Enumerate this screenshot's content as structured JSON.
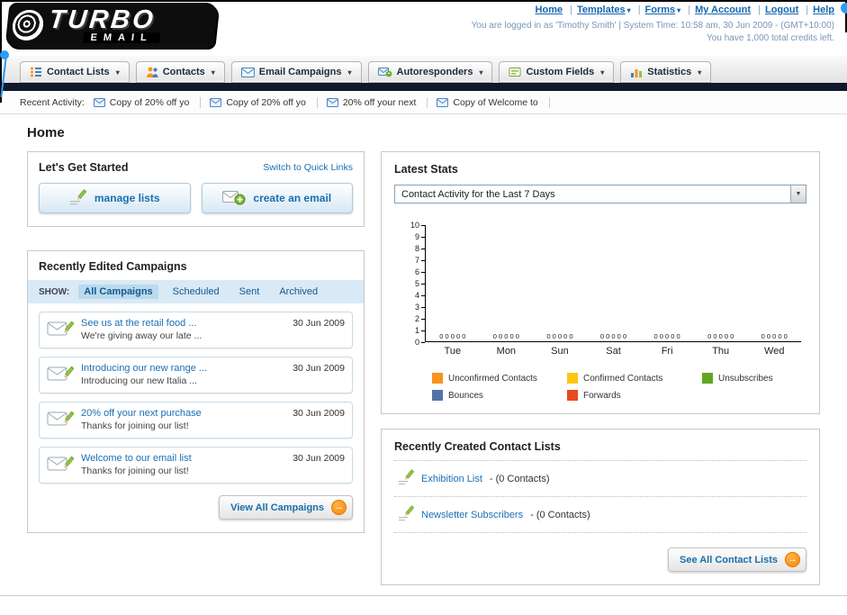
{
  "colors": {
    "link_blue": "#1b6fb5",
    "accent_orange": "#f7941d",
    "nav_dark_bar": "#10182b",
    "filter_bar_blue": "#d9e9f6"
  },
  "header": {
    "logo_line1": "TURBO",
    "logo_line2": "EMAIL",
    "nav": [
      {
        "label": "Home",
        "has_menu": false
      },
      {
        "label": "Templates",
        "has_menu": true
      },
      {
        "label": "Forms",
        "has_menu": true
      },
      {
        "label": "My Account",
        "has_menu": false
      },
      {
        "label": "Logout",
        "has_menu": false
      },
      {
        "label": "Help",
        "has_menu": false
      }
    ],
    "login_info": "You are logged in as 'Timothy Smith' | System Time: 10:58 am, 30 Jun 2009 - (GMT+10:00)",
    "credits": "You have 1,000 total credits left."
  },
  "tabs": [
    {
      "label": "Contact Lists"
    },
    {
      "label": "Contacts"
    },
    {
      "label": "Email Campaigns"
    },
    {
      "label": "Autoresponders"
    },
    {
      "label": "Custom Fields"
    },
    {
      "label": "Statistics"
    }
  ],
  "recent_activity": {
    "label": "Recent Activity:",
    "items": [
      "Copy of 20% off yo",
      "Copy of 20% off yo",
      "20% off your next",
      "Copy of Welcome to"
    ]
  },
  "page": {
    "title": "Home"
  },
  "get_started": {
    "title": "Let's Get Started",
    "switch_link": "Switch to Quick Links",
    "manage_lists": "manage lists",
    "create_email": "create an email"
  },
  "campaigns": {
    "title": "Recently Edited Campaigns",
    "show_label": "SHOW:",
    "filters": [
      "All Campaigns",
      "Scheduled",
      "Sent",
      "Archived"
    ],
    "selected_filter": "All Campaigns",
    "items": [
      {
        "title": "See us at the retail food ...",
        "subtitle": "We're giving away our late ...",
        "date": "30 Jun 2009"
      },
      {
        "title": "Introducing our new range ...",
        "subtitle": "Introducing our new Italia ...",
        "date": "30 Jun 2009"
      },
      {
        "title": "20% off your next purchase",
        "subtitle": "Thanks for joining our list!",
        "date": "30 Jun 2009"
      },
      {
        "title": "Welcome to our email list",
        "subtitle": "Thanks for joining our list!",
        "date": "30 Jun 2009"
      }
    ],
    "view_all": "View All Campaigns"
  },
  "stats": {
    "title": "Latest Stats",
    "filter_selected": "Contact Activity for the Last 7 Days"
  },
  "contact_lists": {
    "title": "Recently Created Contact Lists",
    "items": [
      {
        "name": "Exhibition List",
        "suffix": "- (0 Contacts)"
      },
      {
        "name": "Newsletter Subscribers",
        "suffix": "- (0 Contacts)"
      }
    ],
    "see_all": "See All Contact Lists"
  },
  "chart_data": {
    "type": "bar",
    "title": "Contact Activity for the Last 7 Days",
    "categories": [
      "Tue",
      "Mon",
      "Sun",
      "Sat",
      "Fri",
      "Thu",
      "Wed"
    ],
    "series": [
      {
        "name": "Unconfirmed Contacts",
        "color": "#f7941d",
        "values": [
          0,
          0,
          0,
          0,
          0,
          0,
          0
        ]
      },
      {
        "name": "Confirmed Contacts",
        "color": "#fdc511",
        "values": [
          0,
          0,
          0,
          0,
          0,
          0,
          0
        ]
      },
      {
        "name": "Unsubscribes",
        "color": "#61a621",
        "values": [
          0,
          0,
          0,
          0,
          0,
          0,
          0
        ]
      },
      {
        "name": "Bounces",
        "color": "#5572a7",
        "values": [
          0,
          0,
          0,
          0,
          0,
          0,
          0
        ]
      },
      {
        "name": "Forwards",
        "color": "#e8491d",
        "values": [
          0,
          0,
          0,
          0,
          0,
          0,
          0
        ]
      }
    ],
    "ylim": [
      0,
      10
    ],
    "ylabel": "",
    "xlabel": "",
    "legend_position": "bottom",
    "grid": false
  }
}
